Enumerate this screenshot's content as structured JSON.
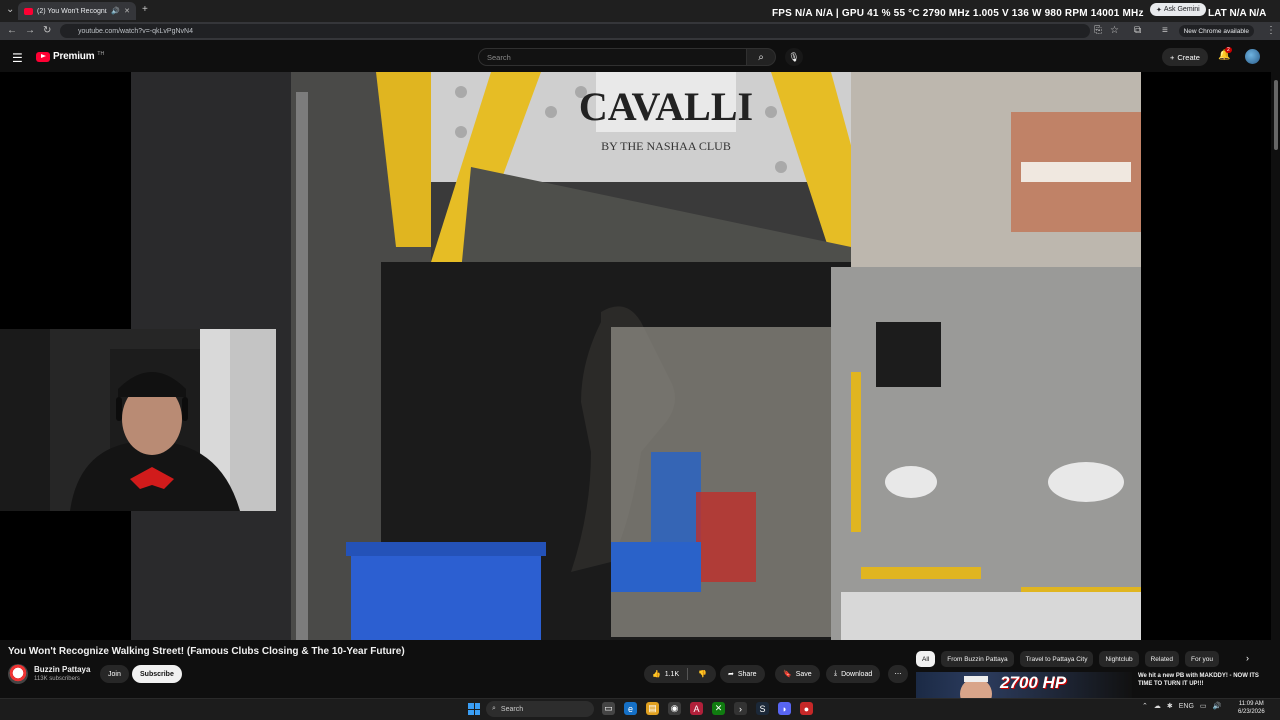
{
  "browser": {
    "tab_title": "(2) You Won't Recognize W",
    "url": "youtube.com/watch?v=-qkLvPgNvN4",
    "new_chrome_label": "New Chrome available",
    "ask_gemini_label": "Ask Gemini"
  },
  "perf_overlay": {
    "text": "FPS  N/A  N/A  |  GPU  41 %  55 °C  2790 MHz  1.005 V  136 W  980 RPM  14001 MHz",
    "lat_text": "LAT  N/A  N/A"
  },
  "masthead": {
    "logo_text": "Premium",
    "logo_sup": "TH",
    "search_placeholder": "Search",
    "create_label": "Create",
    "notification_count": "2"
  },
  "video": {
    "title": "You Won't Recognize Walking Street! (Famous Clubs Closing & The 10-Year Future)",
    "sign_text": "CAVALLI",
    "sign_sub": "BY THE NASHAA CLUB"
  },
  "channel": {
    "name": "Buzzin Pattaya",
    "subscribers": "113K subscribers",
    "join_label": "Join",
    "subscribe_label": "Subscribe"
  },
  "actions": {
    "like_count": "1.1K",
    "share_label": "Share",
    "save_label": "Save",
    "download_label": "Download"
  },
  "chips": [
    "All",
    "From Buzzin Pattaya",
    "Travel to Pattaya City",
    "Nightclub",
    "Related",
    "For you"
  ],
  "recommendation": {
    "thumb_text": "2700 HP",
    "title": "We hit a new PB with MAKDDY! - NOW ITS TIME TO TURN IT UP!!!"
  },
  "taskbar": {
    "search_label": "Search",
    "lang": "ENG",
    "time": "11:09 AM",
    "date": "6/23/2026"
  },
  "colors": {
    "youtube_red": "#ff0033",
    "background": "#0f0f0f",
    "windows_blue": "#3a9ef5"
  }
}
